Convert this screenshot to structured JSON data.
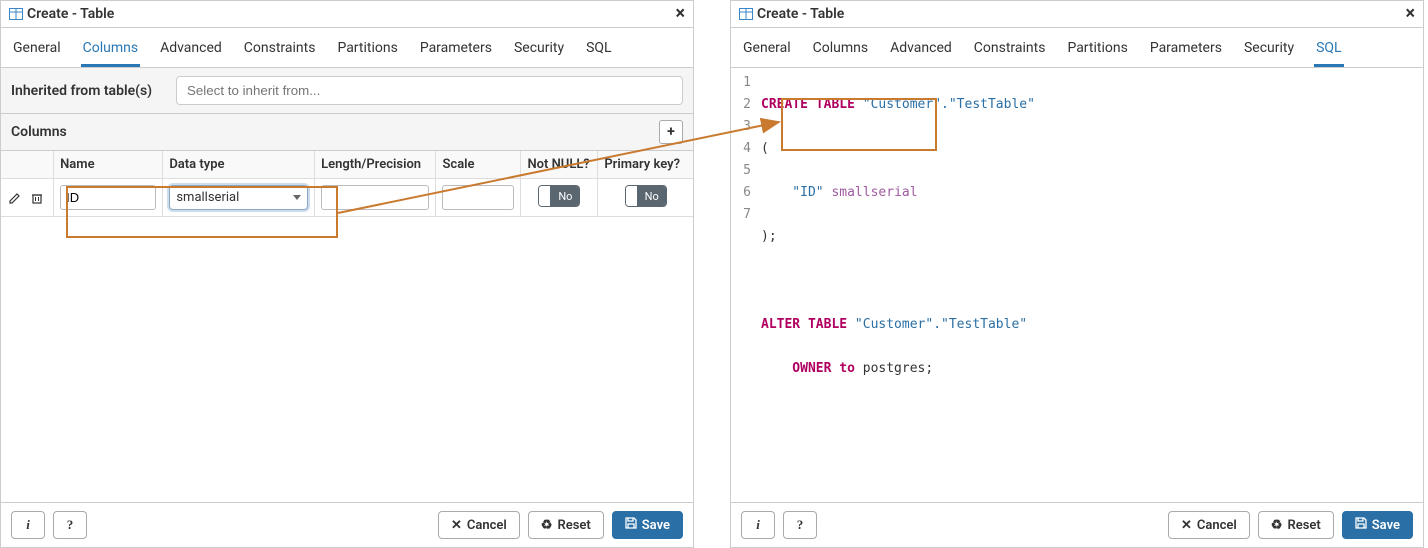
{
  "left": {
    "title": "Create - Table",
    "tabs": [
      "General",
      "Columns",
      "Advanced",
      "Constraints",
      "Partitions",
      "Parameters",
      "Security",
      "SQL"
    ],
    "active_tab": "Columns",
    "inherit_label": "Inherited from table(s)",
    "inherit_placeholder": "Select to inherit from...",
    "section_title": "Columns",
    "col_headers": {
      "name": "Name",
      "data_type": "Data type",
      "length": "Length/Precision",
      "scale": "Scale",
      "not_null": "Not NULL?",
      "primary_key": "Primary key?"
    },
    "rows": [
      {
        "name": "ID",
        "data_type": "smallserial",
        "length": "",
        "scale": "",
        "not_null": "No",
        "primary_key": "No"
      }
    ]
  },
  "right": {
    "title": "Create - Table",
    "tabs": [
      "General",
      "Columns",
      "Advanced",
      "Constraints",
      "Partitions",
      "Parameters",
      "Security",
      "SQL"
    ],
    "active_tab": "SQL",
    "sql_lines": {
      "l1_kw1": "CREATE TABLE",
      "l1_str": "\"Customer\".\"TestTable\"",
      "l2": "(",
      "l3_str": "    \"ID\"",
      "l3_typ": "smallserial",
      "l4": ");",
      "l5": "",
      "l6_kw1": "ALTER TABLE",
      "l6_str": "\"Customer\".\"TestTable\"",
      "l7_kw1": "    OWNER to",
      "l7_id": " postgres",
      "l7_sc": ";"
    },
    "gutter": [
      "1",
      "2",
      "3",
      "4",
      "5",
      "6",
      "7"
    ]
  },
  "footer": {
    "cancel": "Cancel",
    "reset": "Reset",
    "save": "Save",
    "info_label": "i",
    "help_label": "?"
  }
}
